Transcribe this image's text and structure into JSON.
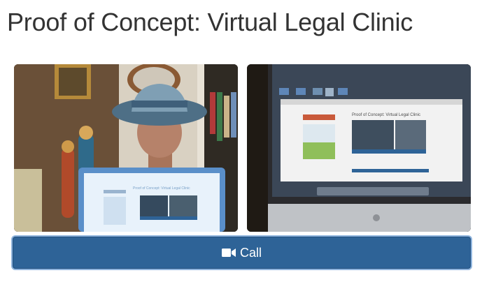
{
  "page": {
    "title": "Proof of Concept: Virtual Legal Clinic"
  },
  "local_video": {
    "laptop_screen_title": "Proof of Concept: Virtual Legal Clinic"
  },
  "remote_video": {
    "screen_title": "Proof of Concept: Virtual Legal Clinic"
  },
  "call_button": {
    "label": "Call",
    "icon": "video-camera-icon",
    "background": "#2e6397"
  }
}
